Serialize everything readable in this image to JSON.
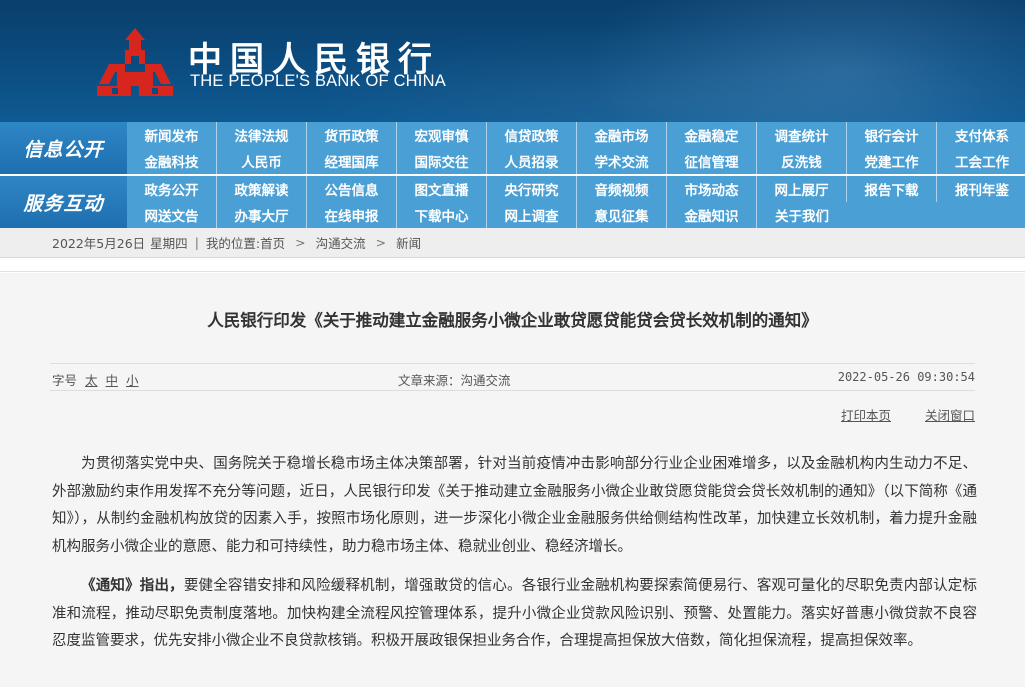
{
  "header": {
    "cn_name": "中国人民银行",
    "en_name": "THE PEOPLE'S BANK OF CHINA",
    "logo_color": "#d7261e",
    "banner_color": "#0b4a7d"
  },
  "nav": {
    "info_title": "信息公开",
    "info_row1": [
      "新闻发布",
      "法律法规",
      "货币政策",
      "宏观审慎",
      "信贷政策",
      "金融市场",
      "金融稳定",
      "调查统计",
      "银行会计",
      "支付体系"
    ],
    "info_row2": [
      "金融科技",
      "人民币",
      "经理国库",
      "国际交往",
      "人员招录",
      "学术交流",
      "征信管理",
      "反洗钱",
      "党建工作",
      "工会工作"
    ],
    "service_title": "服务互动",
    "service_row1": [
      "政务公开",
      "政策解读",
      "公告信息",
      "图文直播",
      "央行研究",
      "音频视频",
      "市场动态",
      "网上展厅",
      "报告下载",
      "报刊年鉴"
    ],
    "service_row2": [
      "网送文告",
      "办事大厅",
      "在线申报",
      "下载中心",
      "网上调查",
      "意见征集",
      "金融知识",
      "关于我们"
    ],
    "bar_color": "#4a9fd5"
  },
  "breadcrumb": {
    "date": "2022年5月26日",
    "weekday": "星期四",
    "sep": "|",
    "location_label": "我的位置:",
    "home": "首页",
    "arrow": ">",
    "section": "沟通交流",
    "current": "新闻"
  },
  "article": {
    "title": "人民银行印发《关于推动建立金融服务小微企业敢贷愿贷能贷会贷长效机制的通知》",
    "font_size_label": "字号",
    "font_sizes": [
      "太",
      "中",
      "小"
    ],
    "source_label": "文章来源：",
    "source": "沟通交流",
    "datetime": "2022-05-26 09:30:54",
    "print_label": "打印本页",
    "close_label": "关闭窗口",
    "para1": "为贯彻落实党中央、国务院关于稳增长稳市场主体决策部署，针对当前疫情冲击影响部分行业企业困难增多，以及金融机构内生动力不足、外部激励约束作用发挥不充分等问题，近日，人民银行印发《关于推动建立金融服务小微企业敢贷愿贷能贷会贷长效机制的通知》（以下简称《通知》），从制约金融机构放贷的因素入手，按照市场化原则，进一步深化小微企业金融服务供给侧结构性改革，加快建立长效机制，着力提升金融机构服务小微企业的意愿、能力和可持续性，助力稳市场主体、稳就业创业、稳经济增长。",
    "para2_lead": "《通知》指出，",
    "para2_rest": "要健全容错安排和风险缓释机制，增强敢贷的信心。各银行业金融机构要探索简便易行、客观可量化的尽职免责内部认定标准和流程，推动尽职免责制度落地。加快构建全流程风控管理体系，提升小微企业贷款风险识别、预警、处置能力。落实好普惠小微贷款不良容忍度监管要求，优先安排小微企业不良贷款核销。积极开展政银保担业务合作，合理提高担保放大倍数，简化担保流程，提高担保效率。"
  }
}
